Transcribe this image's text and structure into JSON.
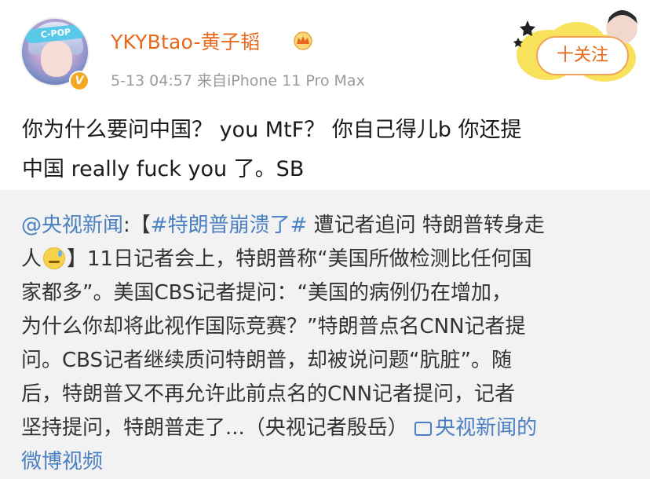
{
  "post": {
    "username": "YKYBtao-黄子韬",
    "meta": "5-13 04:57  来自iPhone 11 Pro Max",
    "follow_label": "十关注",
    "avatar_banner": "C-POP",
    "verified_badge": "V",
    "text_line1": "你为什么要问中国？ you MtF？ 你自己得儿b 你还提",
    "text_line2": "中国 really fuck you 了。SB"
  },
  "repost": {
    "mention": "@央视新闻",
    "colon": ":【",
    "hashtag": "#特朗普崩溃了#",
    "line1_rest": " 遭记者追问 特朗普转身走",
    "line2_a": "人",
    "line2_b": "】11日记者会上，特朗普称“美国所做检测比任何国",
    "line3": "家都多”。美国CBS记者提问：“美国的病例仍在增加，",
    "line4": "为什么你却将此视作国际竞赛？”特朗普点名CNN记者提",
    "line5": "问。CBS记者继续质问特朗普，却被说问题“肮脏”。随",
    "line6": "后，特朗普又不再允许此前点名的CNN记者提问，记者",
    "line7_a": "坚持提问，特朗普走了...（央视记者殷岳） ",
    "video_link": "央视新闻的",
    "line8": "微博视频",
    "emoji_name": "sweat-emoji"
  },
  "colors": {
    "username": "#e8681a",
    "link": "#4a7fc1",
    "repost_bg": "#f2f2f2",
    "meta": "#9a9a9a"
  }
}
